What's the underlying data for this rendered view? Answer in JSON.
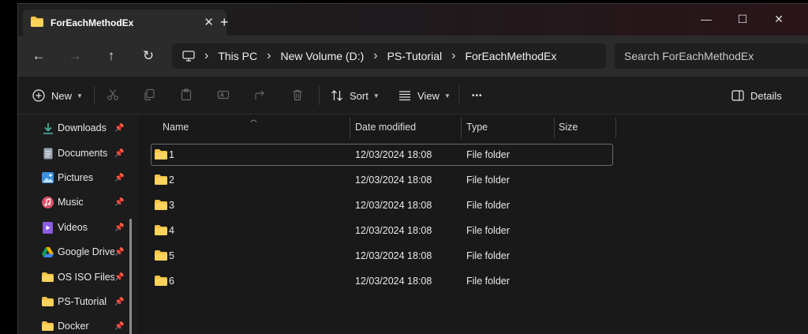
{
  "window": {
    "tab_title": "ForEachMethodEx",
    "tab_close": "✕",
    "new_tab": "+",
    "minimize": "—",
    "maximize": "☐",
    "close": "✕"
  },
  "nav": {
    "back": "←",
    "forward": "→",
    "up": "↑",
    "refresh": "↻",
    "breadcrumbs": [
      "This PC",
      "New Volume (D:)",
      "PS-Tutorial",
      "ForEachMethodEx"
    ],
    "search_placeholder": "Search ForEachMethodEx"
  },
  "toolbar": {
    "new_label": "New",
    "sort_label": "Sort",
    "view_label": "View",
    "more_label": "•••",
    "details_label": "Details"
  },
  "sidebar": {
    "items": [
      {
        "label": "Downloads",
        "icon": "download-icon",
        "pin": "📌"
      },
      {
        "label": "Documents",
        "icon": "documents-icon",
        "pin": "📌"
      },
      {
        "label": "Pictures",
        "icon": "pictures-icon",
        "pin": "📌"
      },
      {
        "label": "Music",
        "icon": "music-icon",
        "pin": "📌"
      },
      {
        "label": "Videos",
        "icon": "videos-icon",
        "pin": "📌"
      },
      {
        "label": "Google Drive",
        "icon": "google-drive-icon",
        "pin": "📌"
      },
      {
        "label": "OS ISO Files",
        "icon": "folder-icon",
        "pin": "📌"
      },
      {
        "label": "PS-Tutorial",
        "icon": "folder-icon",
        "pin": "📌"
      },
      {
        "label": "Docker",
        "icon": "folder-icon",
        "pin": "📌"
      }
    ]
  },
  "columns": {
    "name": "Name",
    "date": "Date modified",
    "type": "Type",
    "size": "Size"
  },
  "files": [
    {
      "name": "1",
      "date": "12/03/2024 18:08",
      "type": "File folder"
    },
    {
      "name": "2",
      "date": "12/03/2024 18:08",
      "type": "File folder"
    },
    {
      "name": "3",
      "date": "12/03/2024 18:08",
      "type": "File folder"
    },
    {
      "name": "4",
      "date": "12/03/2024 18:08",
      "type": "File folder"
    },
    {
      "name": "5",
      "date": "12/03/2024 18:08",
      "type": "File folder"
    },
    {
      "name": "6",
      "date": "12/03/2024 18:08",
      "type": "File folder"
    }
  ],
  "colors": {
    "folder": "#f5c445",
    "accent_blue": "#4aa3ff"
  }
}
